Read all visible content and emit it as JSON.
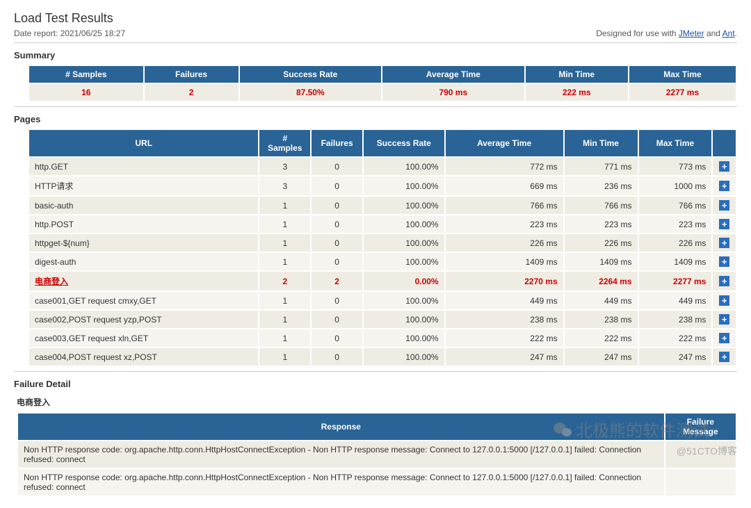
{
  "title": "Load Test Results",
  "date_report": "Date report: 2021/06/25 18:27",
  "designed_prefix": "Designed for use with ",
  "jmeter_link": "JMeter",
  "and_text": " and ",
  "ant_link": "Ant",
  "period": ".",
  "sections": {
    "summary": "Summary",
    "pages": "Pages",
    "failure_detail": "Failure Detail"
  },
  "summary_table": {
    "headers": [
      "# Samples",
      "Failures",
      "Success Rate",
      "Average Time",
      "Min Time",
      "Max Time"
    ],
    "row": [
      "16",
      "2",
      "87.50%",
      "790 ms",
      "222 ms",
      "2277 ms"
    ]
  },
  "pages_table": {
    "headers": [
      "URL",
      "# Samples",
      "Failures",
      "Success Rate",
      "Average Time",
      "Min Time",
      "Max Time",
      ""
    ],
    "rows": [
      {
        "url": "http.GET",
        "samples": "3",
        "failures": "0",
        "rate": "100.00%",
        "avg": "772 ms",
        "min": "771 ms",
        "max": "773 ms",
        "fail": false
      },
      {
        "url": "HTTP请求",
        "samples": "3",
        "failures": "0",
        "rate": "100.00%",
        "avg": "669 ms",
        "min": "236 ms",
        "max": "1000 ms",
        "fail": false
      },
      {
        "url": "basic-auth",
        "samples": "1",
        "failures": "0",
        "rate": "100.00%",
        "avg": "766 ms",
        "min": "766 ms",
        "max": "766 ms",
        "fail": false
      },
      {
        "url": "http.POST",
        "samples": "1",
        "failures": "0",
        "rate": "100.00%",
        "avg": "223 ms",
        "min": "223 ms",
        "max": "223 ms",
        "fail": false
      },
      {
        "url": "httpget-${num}",
        "samples": "1",
        "failures": "0",
        "rate": "100.00%",
        "avg": "226 ms",
        "min": "226 ms",
        "max": "226 ms",
        "fail": false
      },
      {
        "url": "digest-auth",
        "samples": "1",
        "failures": "0",
        "rate": "100.00%",
        "avg": "1409 ms",
        "min": "1409 ms",
        "max": "1409 ms",
        "fail": false
      },
      {
        "url": "电商登入",
        "samples": "2",
        "failures": "2",
        "rate": "0.00%",
        "avg": "2270 ms",
        "min": "2264 ms",
        "max": "2277 ms",
        "fail": true
      },
      {
        "url": "case001,GET request cmxy,GET",
        "samples": "1",
        "failures": "0",
        "rate": "100.00%",
        "avg": "449 ms",
        "min": "449 ms",
        "max": "449 ms",
        "fail": false
      },
      {
        "url": "case002,POST request yzp,POST",
        "samples": "1",
        "failures": "0",
        "rate": "100.00%",
        "avg": "238 ms",
        "min": "238 ms",
        "max": "238 ms",
        "fail": false
      },
      {
        "url": "case003,GET request xln,GET",
        "samples": "1",
        "failures": "0",
        "rate": "100.00%",
        "avg": "222 ms",
        "min": "222 ms",
        "max": "222 ms",
        "fail": false
      },
      {
        "url": "case004,POST request xz,POST",
        "samples": "1",
        "failures": "0",
        "rate": "100.00%",
        "avg": "247 ms",
        "min": "247 ms",
        "max": "247 ms",
        "fail": false
      }
    ]
  },
  "failure_subhead": "电商登入",
  "failure_table": {
    "headers": [
      "Response",
      "Failure Message"
    ],
    "rows": [
      {
        "response": "Non HTTP response code: org.apache.http.conn.HttpHostConnectException - Non HTTP response message: Connect to 127.0.0.1:5000 [/127.0.0.1] failed: Connection refused: connect",
        "msg": ""
      },
      {
        "response": "Non HTTP response code: org.apache.http.conn.HttpHostConnectException - Non HTTP response message: Connect to 127.0.0.1:5000 [/127.0.0.1] failed: Connection refused: connect",
        "msg": ""
      }
    ]
  },
  "watermark1": "北极熊的软件测试",
  "watermark2": "@51CTO博客"
}
